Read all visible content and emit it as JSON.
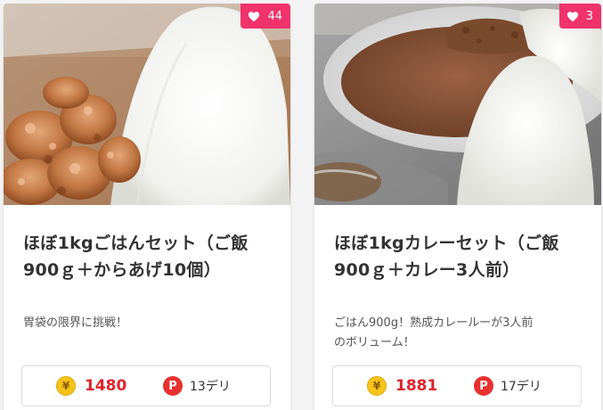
{
  "colors": {
    "accent_pink": "#f0326d",
    "price_red": "#e0222a",
    "coin_gold": "#f5c31a",
    "point_red": "#e83030"
  },
  "products": [
    {
      "likes": "44",
      "title_line1": "ほぼ1kgごはんセット（ご飯",
      "title_line2": "900ｇ＋からあげ10個）",
      "description_line1": "胃袋の限界に挑戦！",
      "description_line2": "",
      "price": "1480",
      "points": "13デリ",
      "image": "rice-and-karaage-photo"
    },
    {
      "likes": "3",
      "title_line1": "ほぼ1kgカレーセット（ご飯",
      "title_line2": "900ｇ＋カレー3人前）",
      "description_line1": "ごはん900g！熟成カレールーが3人前",
      "description_line2": "のボリューム！",
      "price": "1881",
      "points": "17デリ",
      "image": "rice-and-curry-photo"
    }
  ],
  "icons": {
    "yen_symbol": "¥",
    "point_symbol": "P"
  }
}
